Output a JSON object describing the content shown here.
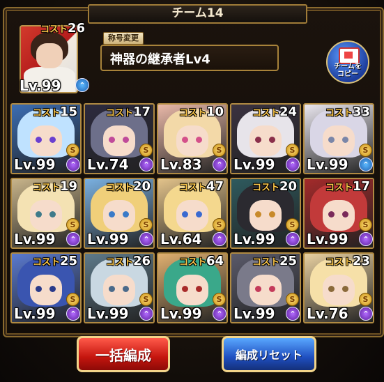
{
  "team": {
    "name": "チーム14"
  },
  "leader": {
    "cost_label": "コスト",
    "cost": "26",
    "level": "Lv.99",
    "upgrade": "blue"
  },
  "title": {
    "label": "称号変更",
    "value": "神器の継承者Lv4"
  },
  "copy_button": {
    "label_line1": "チームを",
    "label_line2": "コピー"
  },
  "cost_label": "コスト",
  "units": [
    {
      "cost": "15",
      "level": "Lv.99",
      "up": "purple",
      "hair": "#bfe2ff",
      "eye": "#6a3fd0",
      "bg": "#3b6db3"
    },
    {
      "cost": "17",
      "level": "Lv.74",
      "up": "purple",
      "hair": "#6d6f8a",
      "eye": "#c04a9a",
      "bg": "#2c2a3e"
    },
    {
      "cost": "10",
      "level": "Lv.83",
      "up": "purple",
      "hair": "#f3d9a8",
      "eye": "#d4508a",
      "bg": "#e9b8a8"
    },
    {
      "cost": "24",
      "level": "Lv.99",
      "up": "purple",
      "hair": "#e7e4ea",
      "eye": "#8a2e4a",
      "bg": "#3a3240"
    },
    {
      "cost": "33",
      "level": "Lv.99",
      "up": "blue",
      "hair": "#d9d6e6",
      "eye": "#7a86a8",
      "bg": "#e9e6ee"
    },
    {
      "cost": "19",
      "level": "Lv.99",
      "up": "purple",
      "hair": "#f4e2b3",
      "eye": "#3f7a8a",
      "bg": "#c8b48a"
    },
    {
      "cost": "20",
      "level": "Lv.99",
      "up": "purple",
      "hair": "#f0cf7a",
      "eye": "#3a7ac8",
      "bg": "#7ab0e0"
    },
    {
      "cost": "47",
      "level": "Lv.64",
      "up": "purple",
      "hair": "#f4d88e",
      "eye": "#3a6ad0",
      "bg": "#e2c28a"
    },
    {
      "cost": "20",
      "level": "Lv.99",
      "up": "purple",
      "hair": "#2b2a30",
      "eye": "#c88a2a",
      "bg": "#2e5a5e"
    },
    {
      "cost": "17",
      "level": "Lv.99",
      "up": "purple",
      "hair": "#c23a3a",
      "eye": "#7a2a5a",
      "bg": "#a32a2a"
    },
    {
      "cost": "25",
      "level": "Lv.99",
      "up": "purple",
      "hair": "#3a55b0",
      "eye": "#2a3a8a",
      "bg": "#5a7ad0"
    },
    {
      "cost": "26",
      "level": "Lv.99",
      "up": "purple",
      "hair": "#c9d8e2",
      "eye": "#4a6a8a",
      "bg": "#5e7a8a"
    },
    {
      "cost": "64",
      "level": "Lv.99",
      "up": "purple",
      "hair": "#3aa88a",
      "eye": "#a82a2a",
      "bg": "#e0b070"
    },
    {
      "cost": "25",
      "level": "Lv.99",
      "up": "purple",
      "hair": "#7a7a8a",
      "eye": "#c43a5a",
      "bg": "#5a5a6a"
    },
    {
      "cost": "23",
      "level": "Lv.76",
      "up": "purple",
      "hair": "#f6e0a8",
      "eye": "#8a6a3a",
      "bg": "#e8d0a0"
    }
  ],
  "buttons": {
    "auto": "一括編成",
    "reset": "編成リセット"
  },
  "s_badge": "S",
  "up_glyph": "⌃"
}
